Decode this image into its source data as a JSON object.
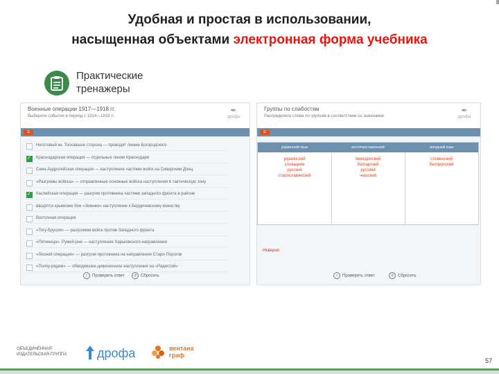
{
  "slide": {
    "title_line1": "Удобная и простая в использовании,",
    "title_line2_prefix": "насыщенная объектами ",
    "title_line2_highlight": "электронная форма учебника",
    "section_label": "Практические тренажеры",
    "page_number": "57"
  },
  "left_panel": {
    "title": "Военные операции 1917—1918 гг.",
    "subtitle": "Выберите события в период с 1914—1918 гг.",
    "tasks": [
      {
        "text": "Неготовый кн. Тоскавшее сторона — проводят линию Богородского",
        "checked": false
      },
      {
        "text": "Краснодарская операция — отдельные линии Краснодаре",
        "checked": true
      },
      {
        "text": "Сиен-Ардрогейская операция — наступление частями войск на Сиверским Донц",
        "checked": false
      },
      {
        "text": "«Разгромы войска» — отправленные основные войска наступления в тактическую зону",
        "checked": false
      },
      {
        "text": "Каспийская операция — разгром противника частями западного фронта в районе",
        "checked": true
      },
      {
        "text": "вводятся крымские бои «Зимнее» наступление к Бердичевскому воинству",
        "checked": false
      },
      {
        "text": "Восточная операция",
        "checked": false
      },
      {
        "text": "«Тогу-Брусия» — разгромом войск против Западного фронта",
        "checked": false
      },
      {
        "text": "«Пятеница». Ружей-рне — наступление Харьковского направления",
        "checked": false
      },
      {
        "text": "«Лесной операция» — разгром противника на направлении Старо-Порогов",
        "checked": false
      },
      {
        "text": "«Полку-рядем» — обводившее дивизионное наступление на «Радистой»",
        "checked": false
      }
    ],
    "footer_hint": "Проверить ответ",
    "footer_again": "Сбросить",
    "logo_caption": "дрофа"
  },
  "right_panel": {
    "title": "Группы по слабостям",
    "subtitle": "Распределите слова по группам в соответствии со значением",
    "columns": [
      {
        "header": "украинский язык",
        "words": [
          "украинский",
          "словацкие",
          "русский",
          "старославянский"
        ]
      },
      {
        "header": "восточнославянский",
        "words": [
          "македонский",
          "болгарский",
          "русский",
          "чешский"
        ]
      },
      {
        "header": "западный язык",
        "words": [
          "словенский",
          "белорусский"
        ]
      }
    ],
    "answer_label": "Неверно",
    "footer_hint": "Проверить ответ",
    "footer_again": "Сбросить",
    "logo_caption": "дрофа"
  },
  "footer": {
    "publisher_line1": "ОБЪЕДИНЁННАЯ",
    "publisher_line2": "ИЗДАТЕЛЬСКАЯ ГРУППА",
    "drofa": "дрофа",
    "ventana_1": "вентана",
    "ventana_2": "граф"
  },
  "colors": {
    "title_accent": "#e8140e",
    "panel_bar": "#6c90ad",
    "check_green": "#2f9e44",
    "drofa_blue": "#3a8bc9",
    "ventana_orange": "#e8751a"
  }
}
